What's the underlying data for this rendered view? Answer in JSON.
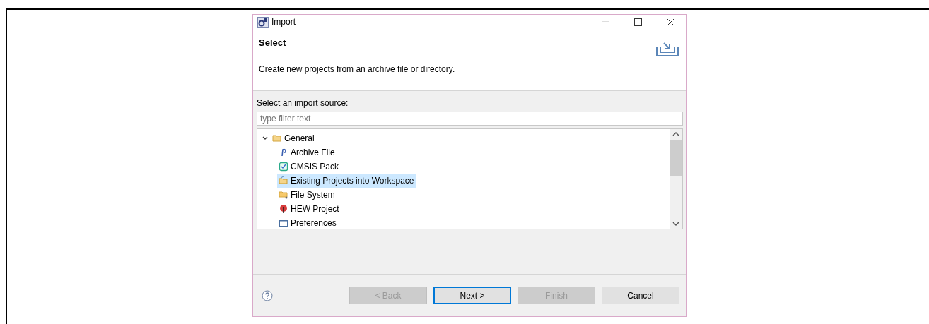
{
  "window": {
    "title": "Import"
  },
  "header": {
    "title": "Select",
    "description": "Create new projects from an archive file or directory."
  },
  "source_label": "Select an import source:",
  "filter": {
    "placeholder": "type filter text"
  },
  "tree": [
    {
      "label": "General",
      "kind": "folder",
      "expanded": true,
      "selected": false,
      "children": [
        {
          "label": "Archive File",
          "kind": "archive",
          "selected": false
        },
        {
          "label": "CMSIS Pack",
          "kind": "pack",
          "selected": false
        },
        {
          "label": "Existing Projects into Workspace",
          "kind": "projects",
          "selected": true
        },
        {
          "label": "File System",
          "kind": "filesystem",
          "selected": false
        },
        {
          "label": "HEW Project",
          "kind": "hew",
          "selected": false
        },
        {
          "label": "Preferences",
          "kind": "preferences",
          "selected": false
        }
      ]
    }
  ],
  "buttons": [
    {
      "label": "< Back",
      "disabled": true,
      "default": false
    },
    {
      "label": "Next >",
      "disabled": false,
      "default": true
    },
    {
      "label": "Finish",
      "disabled": true,
      "default": false
    },
    {
      "label": "Cancel",
      "disabled": false,
      "default": false
    }
  ]
}
